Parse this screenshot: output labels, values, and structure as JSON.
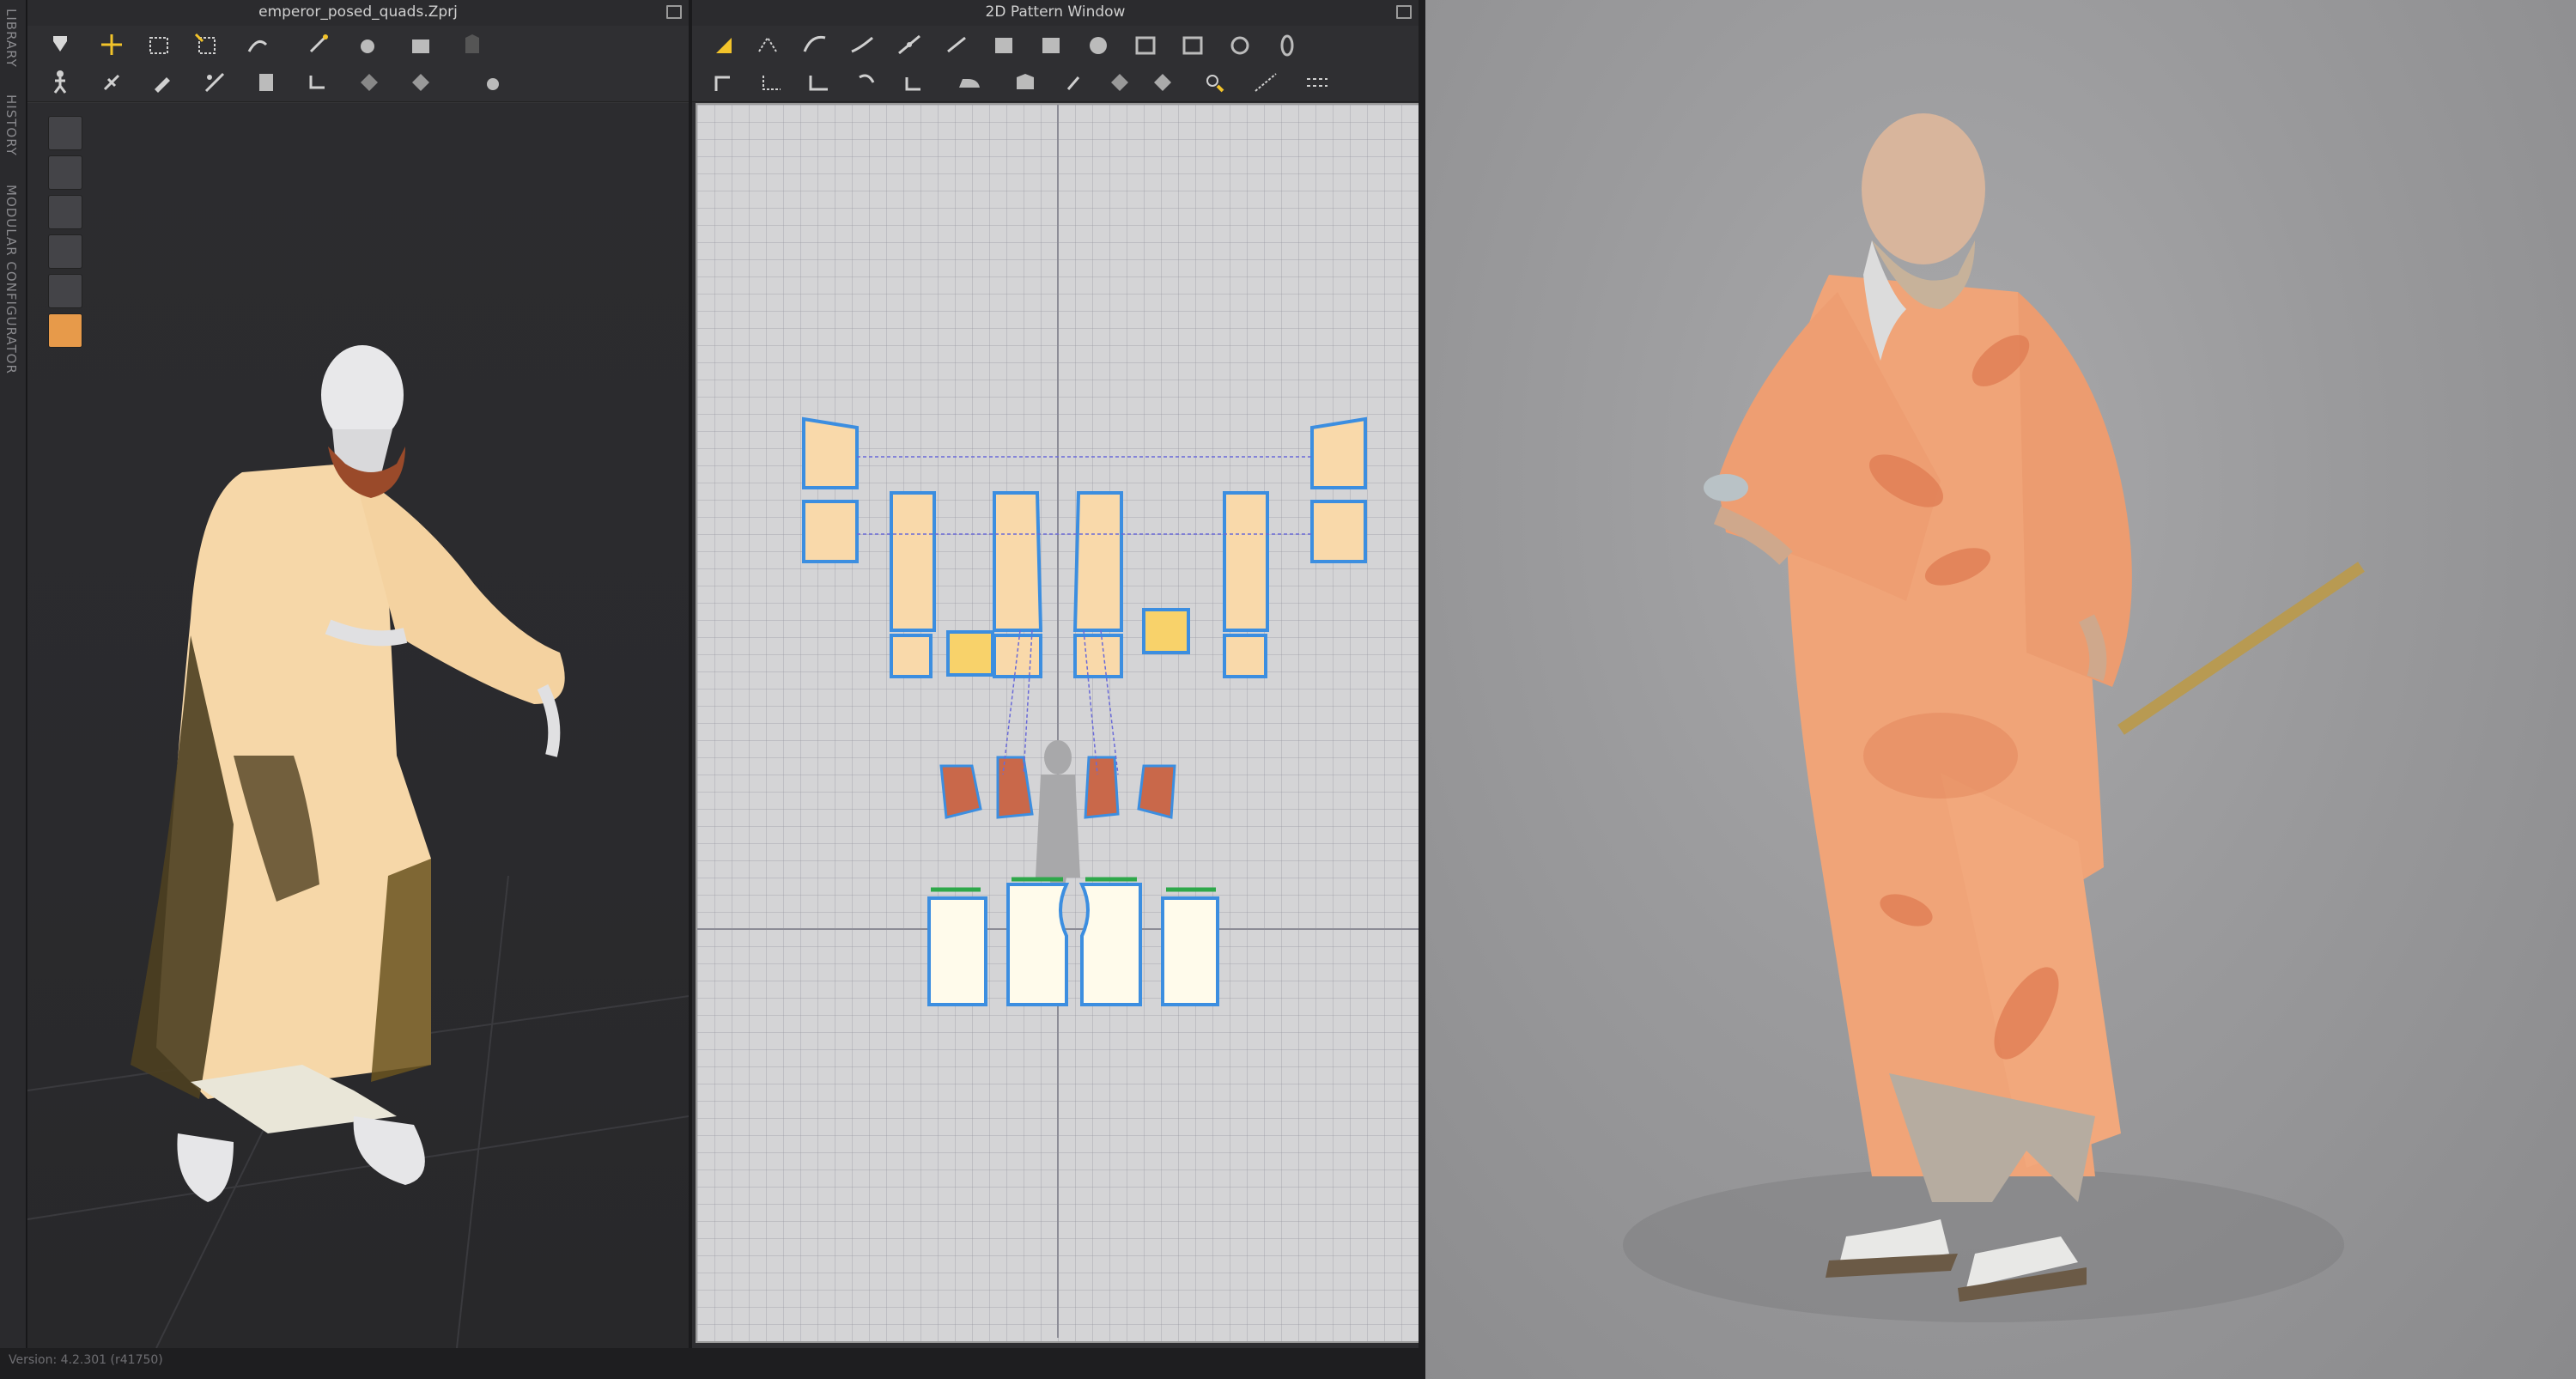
{
  "sidebar": {
    "tabs": [
      "LIBRARY",
      "HISTORY",
      "MODULAR CONFIGURATOR"
    ]
  },
  "window3d": {
    "title": "emperor_posed_quads.Zprj"
  },
  "window2d": {
    "title": "2D Pattern Window"
  },
  "status": {
    "version": "Version: 4.2.301 (r41750)"
  },
  "colors": {
    "fabric_light": "#f8d8a8",
    "fabric_dark": "#5a4a28",
    "pattern_fill": "#f9d9aa",
    "pattern_outline": "#3c8ee0",
    "accent_yellow": "#f2c32a",
    "render_robe": "#f0a478"
  },
  "icons3d": [
    "simulation-icon",
    "transform-icon",
    "select-box-icon",
    "select-area-icon",
    "pin-icon",
    "wind-icon",
    "fold-icon",
    "arrange-icon",
    "shape-icon",
    "avatar-icon"
  ],
  "icons2d": [
    "transform-pattern-icon",
    "edit-points-icon",
    "curve-icon",
    "curve-point-icon",
    "add-point-icon",
    "cut-icon",
    "rect-icon",
    "circle-icon",
    "internal-rect-icon",
    "internal-circle-icon",
    "dart-icon",
    "seam-icon",
    "segment-sewing-icon",
    "free-sewing-icon",
    "tack-icon",
    "iron-icon",
    "fold-line-icon",
    "symmetry-icon",
    "trace-icon",
    "line-icon",
    "dashed-line-icon"
  ]
}
